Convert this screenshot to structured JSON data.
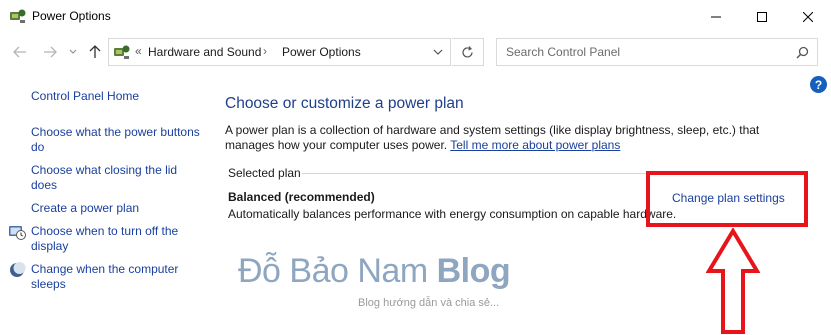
{
  "window": {
    "title": "Power Options"
  },
  "address": {
    "crumbs": [
      "Hardware and Sound",
      "Power Options"
    ]
  },
  "search": {
    "placeholder": "Search Control Panel"
  },
  "sidebar": {
    "home": "Control Panel Home",
    "items": [
      {
        "label": "Choose what the power buttons do",
        "icon": "none"
      },
      {
        "label": "Choose what closing the lid does",
        "icon": "none"
      },
      {
        "label": "Create a power plan",
        "icon": "none"
      },
      {
        "label": "Choose when to turn off the display",
        "icon": "display-clock-icon"
      },
      {
        "label": "Change when the computer sleeps",
        "icon": "moon-icon"
      }
    ]
  },
  "main": {
    "title": "Choose or customize a power plan",
    "description": "A power plan is a collection of hardware and system settings (like display brightness, sleep, etc.) that manages how your computer uses power.",
    "description_link": "Tell me more about power plans",
    "section_label": "Selected plan",
    "plan": {
      "name": "Balanced (recommended)",
      "description": "Automatically balances performance with energy consumption on capable hardware.",
      "change_link": "Change plan settings"
    }
  },
  "watermark": {
    "title_light": "Đỗ Bảo Nam ",
    "title_bold": "Blog",
    "subtitle": "Blog hướng dẫn và chia sẻ..."
  },
  "colors": {
    "link": "#1a3f9e",
    "title": "#1e3f8a",
    "annotation": "#e8141b",
    "help": "#1560bd"
  }
}
